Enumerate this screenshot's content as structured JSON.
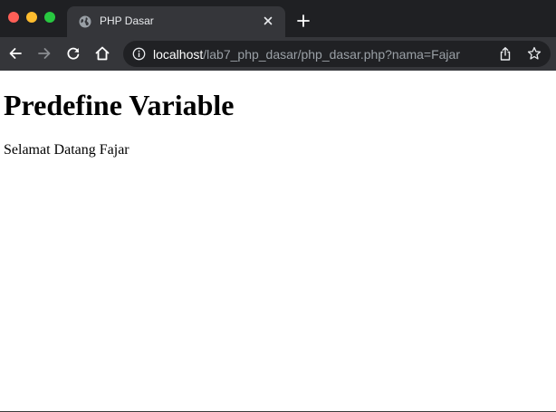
{
  "browser": {
    "tab": {
      "title": "PHP Dasar",
      "favicon": "globe-icon"
    },
    "toolbar": {
      "icons": [
        "back-arrow-icon",
        "forward-arrow-icon",
        "reload-icon",
        "home-icon",
        "info-icon",
        "share-icon",
        "star-icon"
      ]
    },
    "address_bar": {
      "host": "localhost",
      "path": "/lab7_php_dasar/php_dasar.php?nama=Fajar"
    },
    "colors": {
      "tabstrip": "#1f2023",
      "toolbar": "#35363a",
      "omnibox": "#202124",
      "close": "#fe5f57",
      "minimize": "#febc2e",
      "maximize": "#28c840"
    }
  },
  "page": {
    "heading": "Predefine Variable",
    "greeting": "Selamat Datang Fajar"
  }
}
